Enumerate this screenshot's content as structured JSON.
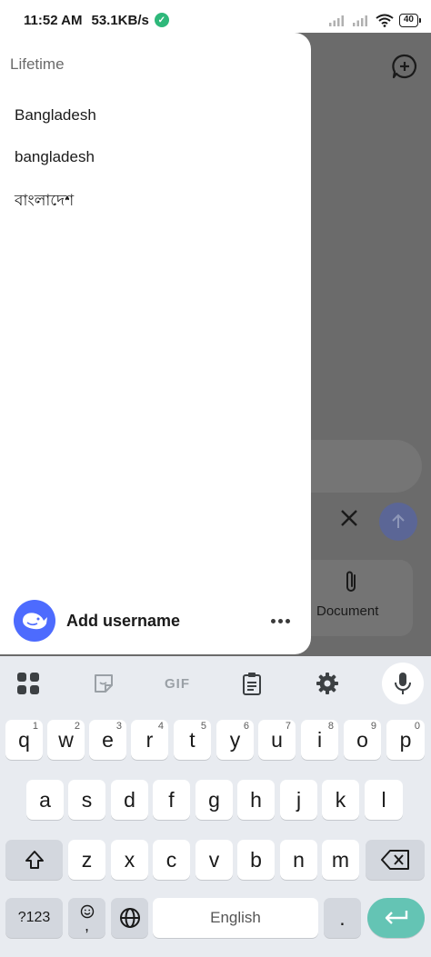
{
  "status_bar": {
    "time": "11:52 AM",
    "speed": "53.1KB/s",
    "battery": "40"
  },
  "background_app": {
    "document_label": "Document"
  },
  "drawer": {
    "heading": "Lifetime",
    "history": [
      {
        "label": "Bangladesh"
      },
      {
        "label": "bangladesh"
      },
      {
        "label": "বাংলাদেশ"
      }
    ],
    "profile": {
      "username": "Add username"
    }
  },
  "keyboard": {
    "toolbar_icons": [
      "apps-icon",
      "sticker-icon",
      "gif-icon",
      "clipboard-icon",
      "settings-icon",
      "mic-icon"
    ],
    "gif_label": "GIF",
    "row1": [
      {
        "key": "q",
        "hint": "1"
      },
      {
        "key": "w",
        "hint": "2"
      },
      {
        "key": "e",
        "hint": "3"
      },
      {
        "key": "r",
        "hint": "4"
      },
      {
        "key": "t",
        "hint": "5"
      },
      {
        "key": "y",
        "hint": "6"
      },
      {
        "key": "u",
        "hint": "7"
      },
      {
        "key": "i",
        "hint": "8"
      },
      {
        "key": "o",
        "hint": "9"
      },
      {
        "key": "p",
        "hint": "0"
      }
    ],
    "row2": [
      "a",
      "s",
      "d",
      "f",
      "g",
      "h",
      "j",
      "k",
      "l"
    ],
    "row3": [
      "z",
      "x",
      "c",
      "v",
      "b",
      "n",
      "m"
    ],
    "symbols_label": "?123",
    "comma_label": ",",
    "space_label": "English",
    "period_label": ".",
    "colors": {
      "background": "#e8ebf0",
      "key": "#ffffff",
      "function_key": "#d3d7de",
      "enter": "#64c4b4"
    }
  },
  "colors": {
    "brand": "#4d6bfe",
    "status_ok": "#2eb87a",
    "scrim": "#6b6b6b"
  }
}
